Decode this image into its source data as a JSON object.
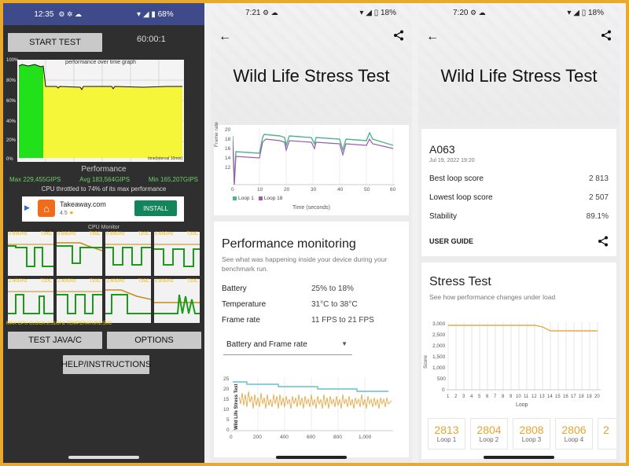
{
  "phone1": {
    "status": {
      "time": "12:35",
      "battery": "68%"
    },
    "start_label": "START TEST",
    "timer": "60:00:1",
    "graph_title": "performance over time graph",
    "graph_footer": "time(interval 10min)",
    "y_ticks": [
      "100%",
      "80%",
      "60%",
      "40%",
      "20%",
      "0%"
    ],
    "perf_title": "Performance",
    "max": "Max 229,455GIPS",
    "avg": "Avg 183,564GIPS",
    "min": "Min 165,207GIPS",
    "throttle": "CPU throttled to 74% of its max performance",
    "ad": {
      "name": "Takeaway.com",
      "rating": "4.5",
      "install": "INSTALL"
    },
    "cpu_monitor": "CPU Monitor",
    "cores": [
      {
        "freq": "0.69GHz",
        "temp": "T34C"
      },
      {
        "freq": "0.69GHz",
        "temp": "T35C"
      },
      {
        "freq": "0.69GHz",
        "temp": "T20C"
      },
      {
        "freq": "0.69GHz",
        "temp": "T20C"
      },
      {
        "freq": "2.40GHz",
        "temp": "T20C"
      },
      {
        "freq": "2.40GHz",
        "temp": "T20C"
      },
      {
        "freq": "2.40GHz",
        "temp": "T35C"
      },
      {
        "freq": "0.80GHz",
        "temp": "T20C"
      }
    ],
    "max_clock": "MAX CPU CLOCK:2.51GHz",
    "temperature": "TEMPERATURE:50C",
    "test_java": "TEST JAVA/C",
    "options": "OPTIONS",
    "help": "HELP/INSTRUCTIONS"
  },
  "phone2": {
    "status": {
      "time": "7:21",
      "battery": "18%"
    },
    "title": "Wild Life Stress Test",
    "chart_top": {
      "ylabel": "Frame rate",
      "xlabel": "Time (seconds)",
      "x_ticks": [
        "0",
        "10",
        "20",
        "30",
        "40",
        "50",
        "60"
      ],
      "y_ticks": [
        "20",
        "18",
        "16",
        "14",
        "12"
      ],
      "legend": [
        "Loop 1",
        "Loop 18"
      ]
    },
    "perf_monitoring": {
      "title": "Performance monitoring",
      "subtitle": "See what was happening inside your device during your benchmark run.",
      "rows": [
        {
          "label": "Battery",
          "value": "25% to 18%"
        },
        {
          "label": "Temperature",
          "value": "31°C to 38°C"
        },
        {
          "label": "Frame rate",
          "value": "11 FPS to 21 FPS"
        }
      ],
      "dropdown": "Battery and Frame rate",
      "chart_label": "Wild Life Stress Test",
      "y_ticks": [
        "25",
        "20",
        "15",
        "10",
        "5",
        "0"
      ],
      "x_ticks": [
        "0",
        "200",
        "400",
        "600",
        "800",
        "1,000"
      ]
    }
  },
  "phone3": {
    "status": {
      "time": "7:20",
      "battery": "18%"
    },
    "title": "Wild Life Stress Test",
    "device": "A063",
    "date": "Jul 19, 2022 19:20",
    "rows": [
      {
        "label": "Best loop score",
        "value": "2 813"
      },
      {
        "label": "Lowest loop score",
        "value": "2 507"
      },
      {
        "label": "Stability",
        "value": "89.1%"
      }
    ],
    "user_guide": "USER GUIDE",
    "stress_title": "Stress Test",
    "stress_sub": "See how performance changes under load",
    "y_ticks": [
      "3,000",
      "2,500",
      "2,000",
      "1,500",
      "1,000",
      "500",
      "0"
    ],
    "ylabel": "Score",
    "xlabel": "Loop",
    "x_ticks": [
      "1",
      "2",
      "3",
      "4",
      "5",
      "6",
      "7",
      "8",
      "9",
      "10",
      "11",
      "12",
      "13",
      "14",
      "15",
      "16",
      "17",
      "18",
      "19",
      "20"
    ],
    "loops": [
      {
        "score": "2813",
        "label": "Loop 1"
      },
      {
        "score": "2804",
        "label": "Loop 2"
      },
      {
        "score": "2808",
        "label": "Loop 3"
      },
      {
        "score": "2806",
        "label": "Loop 4"
      }
    ]
  }
}
